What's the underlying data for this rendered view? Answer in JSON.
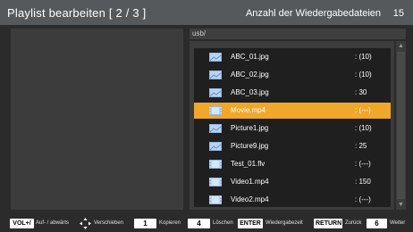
{
  "header": {
    "title": "Playlist bearbeiten  [ 2 / 3 ]",
    "count_label": "Anzahl der Wiedergabedateien",
    "count_value": "15"
  },
  "path": "usb/",
  "files": [
    {
      "name": "ABC_01.jpg",
      "duration": ": (10)",
      "icon": "image-file-icon",
      "selected": false
    },
    {
      "name": "ABC_02.jpg",
      "duration": ": (10)",
      "icon": "image-file-icon",
      "selected": false
    },
    {
      "name": "ABC_03.jpg",
      "duration": ": 30",
      "icon": "image-file-icon",
      "selected": false
    },
    {
      "name": "Movie.mp4",
      "duration": ": (---)",
      "icon": "video-file-icon",
      "selected": true
    },
    {
      "name": "Picture1.jpg",
      "duration": ": (10)",
      "icon": "image-file-icon",
      "selected": false
    },
    {
      "name": "Picture9.jpg",
      "duration": ": 25",
      "icon": "image-file-icon",
      "selected": false
    },
    {
      "name": "Test_01.flv",
      "duration": ": (---)",
      "icon": "video-file-icon",
      "selected": false
    },
    {
      "name": "Video1.mp4",
      "duration": ": 150",
      "icon": "video-file-icon",
      "selected": false
    },
    {
      "name": "Video2.mp4",
      "duration": ": (---)",
      "icon": "video-file-icon",
      "selected": false
    }
  ],
  "footer": {
    "vol_key": "VOL+/−",
    "vol_label": "Auf- / abwärts",
    "move_label": "Verschieben",
    "copy_key": "1",
    "copy_label": "Kopieren",
    "delete_key": "4",
    "delete_label": "Löschen",
    "enter_key": "ENTER",
    "enter_label": "Wiedergabezeit",
    "return_key": "RETURN",
    "return_label": "Zurück",
    "next_key": "6",
    "next_label": "Weiter"
  },
  "colors": {
    "header_bg": "#55595c",
    "selection": "#f0a72a",
    "list_bg": "#1f1f1f",
    "panel_bg": "#3c3c3c",
    "icon_blue": "#8fb7e8"
  }
}
